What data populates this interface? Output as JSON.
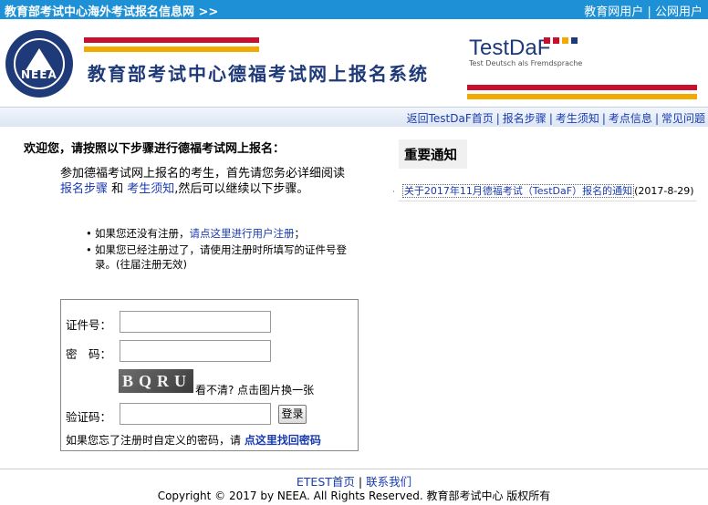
{
  "topbar": {
    "site_title": "教育部考试中心海外考试报名信息网 >>",
    "links": [
      "教育网用户",
      "公网用户"
    ],
    "separator": "|"
  },
  "banner": {
    "logo_text": "NEEA",
    "system_title": "教育部考试中心德福考试网上报名系统",
    "testdaf_name": "TestDaF",
    "testdaf_sub": "Test Deutsch als Fremdsprache",
    "stripe_colors": [
      "#c8102e",
      "#f2a900"
    ],
    "brand_color": "#1f3a78"
  },
  "nav": {
    "items": [
      "返回TestDaF首页",
      "报名步骤",
      "考生须知",
      "考点信息",
      "常见问题"
    ]
  },
  "main": {
    "welcome": "欢迎您，请按照以下步骤进行德福考试网上报名：",
    "intro_1": "参加德福考试网上报名的考生，首先请您务必详细阅读 ",
    "intro_link_1": "报名步骤",
    "intro_2": " 和 ",
    "intro_link_2": "考生须知",
    "intro_3": ",然后可以继续以下步骤。",
    "bullet_1_prefix": "如果您还没有注册，",
    "bullet_1_link": "请点这里进行用户注册",
    "bullet_1_suffix": "；",
    "bullet_2": "如果您已经注册过了，请使用注册时所填写的证件号登录。(往届注册无效)"
  },
  "login": {
    "id_label": "证件号：",
    "id_value": "",
    "password_label": "密　码：",
    "password_value": "",
    "captcha_text": "BQRU",
    "captcha_tip": "看不清? 点击图片换一张",
    "code_label": "验证码：",
    "code_value": "",
    "submit_label": "登录",
    "forgot_prefix": "如果您忘了注册时自定义的密码，请 ",
    "forgot_link": "点这里找回密码"
  },
  "notice": {
    "heading": "重要通知",
    "items": [
      {
        "title": "关于2017年11月德福考试（TestDaF）报名的通知",
        "date": "(2017-8-29)"
      }
    ]
  },
  "footer": {
    "links": [
      "ETEST首页",
      "联系我们"
    ],
    "separator": "|",
    "copyright": "Copyright © 2017 by NEEA. All Rights Reserved. 教育部考试中心 版权所有"
  }
}
